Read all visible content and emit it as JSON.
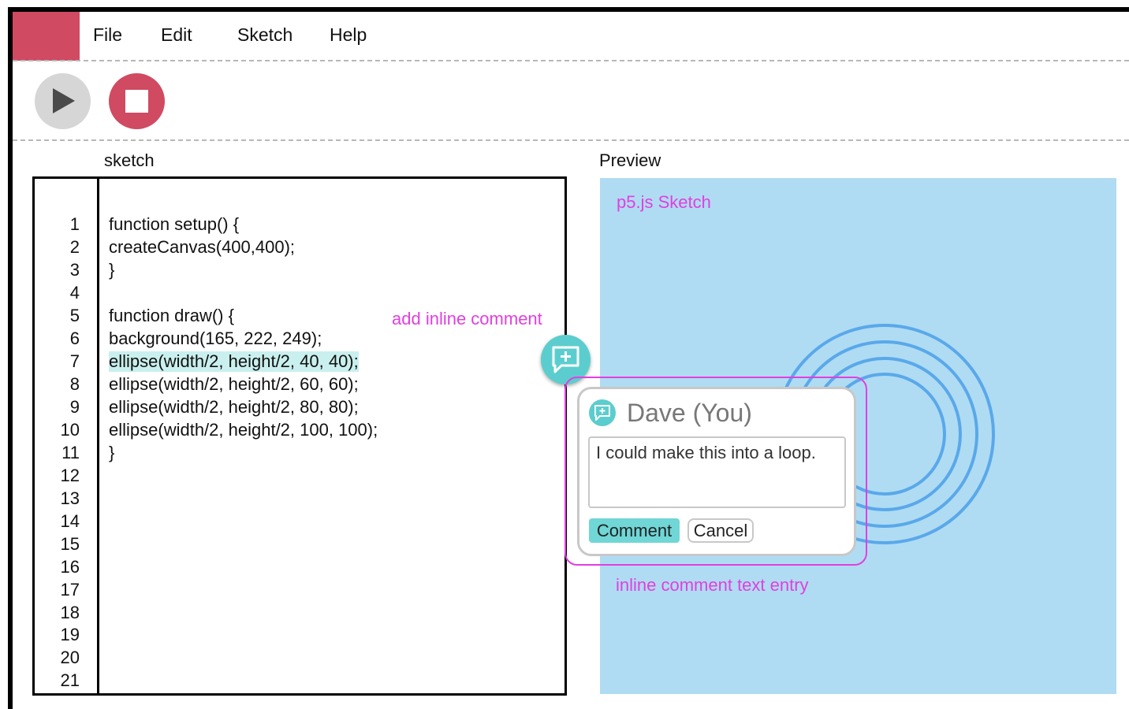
{
  "menu": {
    "items": [
      "File",
      "Edit",
      "Sketch",
      "Help"
    ]
  },
  "colors": {
    "brand": "#d04a62",
    "accent": "#5ccdce",
    "annotation": "#e23fe0",
    "preview_bg": "#afdcf3",
    "circle_stroke": "#5aa8ea"
  },
  "toolbar": {
    "run_icon": "play-icon",
    "stop_icon": "stop-icon"
  },
  "editor": {
    "label": "sketch",
    "line_numbers": [
      "1",
      "2",
      "3",
      "4",
      "5",
      "6",
      "7",
      "8",
      "9",
      "10",
      "11",
      "12",
      "13",
      "14",
      "15",
      "16",
      "17",
      "18",
      "19",
      "20",
      "21"
    ],
    "code": [
      "function setup() {",
      "createCanvas(400,400);",
      "}",
      "",
      "function draw() {",
      "background(165, 222, 249);",
      "ellipse(width/2, height/2, 40, 40);",
      "ellipse(width/2, height/2, 60, 60);",
      "ellipse(width/2, height/2, 80, 80);",
      "ellipse(width/2, height/2, 100, 100);",
      "}"
    ],
    "highlighted_line": 7
  },
  "preview": {
    "label": "Preview",
    "sketch_title": "p5.js Sketch"
  },
  "annotations": {
    "add_inline_comment": "add inline comment",
    "inline_comment_entry": "inline comment text entry"
  },
  "comment": {
    "add_icon": "comment-add-icon",
    "user": "Dave (You)",
    "text": "I could make this into a loop.",
    "submit_label": "Comment",
    "cancel_label": "Cancel"
  }
}
